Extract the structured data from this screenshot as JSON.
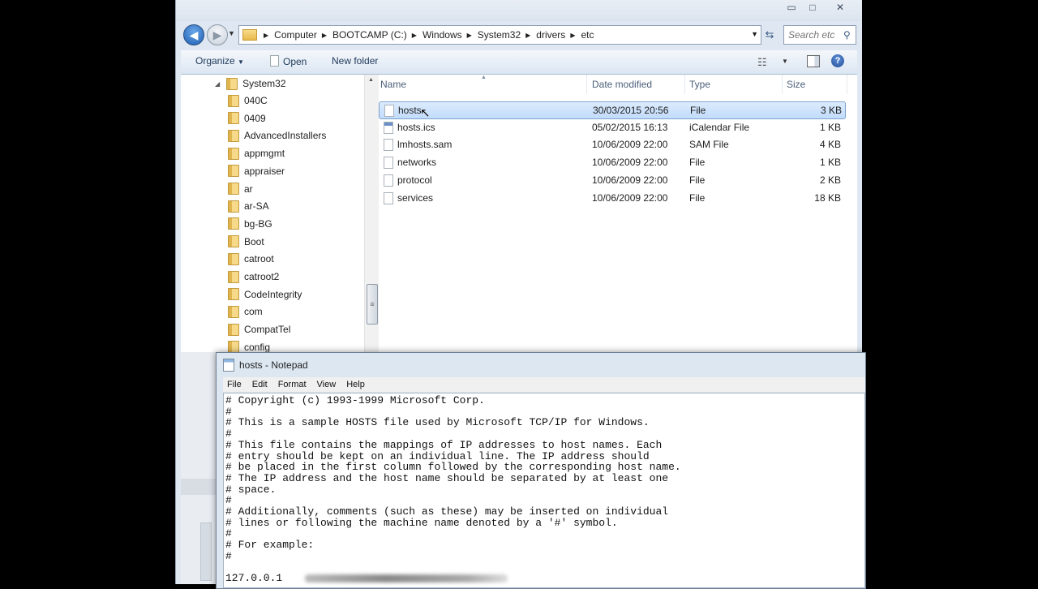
{
  "explorer": {
    "window_controls": {
      "minimize": "▭",
      "maximize": "□",
      "close": "✕"
    },
    "nav": {
      "back_glyph": "◀",
      "forward_glyph": "▶"
    },
    "breadcrumb": [
      {
        "label": "Computer"
      },
      {
        "label": "BOOTCAMP (C:)"
      },
      {
        "label": "Windows"
      },
      {
        "label": "System32"
      },
      {
        "label": "drivers"
      },
      {
        "label": "etc"
      }
    ],
    "search": {
      "placeholder": "Search etc"
    },
    "toolbar": {
      "organize_label": "Organize",
      "open_label": "Open",
      "new_folder_label": "New folder"
    },
    "tree": {
      "root": "System32",
      "items": [
        "040C",
        "0409",
        "AdvancedInstallers",
        "appmgmt",
        "appraiser",
        "ar",
        "ar-SA",
        "bg-BG",
        "Boot",
        "catroot",
        "catroot2",
        "CodeIntegrity",
        "com",
        "CompatTel",
        "config"
      ]
    },
    "columns": {
      "name": "Name",
      "date_modified": "Date modified",
      "type": "Type",
      "size": "Size"
    },
    "files": [
      {
        "name": "hosts",
        "date": "30/03/2015 20:56",
        "type": "File",
        "size": "3 KB",
        "selected": true,
        "icon": "file-icon"
      },
      {
        "name": "hosts.ics",
        "date": "05/02/2015 16:13",
        "type": "iCalendar File",
        "size": "1 KB",
        "selected": false,
        "icon": "calendar-file-icon"
      },
      {
        "name": "lmhosts.sam",
        "date": "10/06/2009 22:00",
        "type": "SAM File",
        "size": "4 KB",
        "selected": false,
        "icon": "file-icon"
      },
      {
        "name": "networks",
        "date": "10/06/2009 22:00",
        "type": "File",
        "size": "1 KB",
        "selected": false,
        "icon": "file-icon"
      },
      {
        "name": "protocol",
        "date": "10/06/2009 22:00",
        "type": "File",
        "size": "2 KB",
        "selected": false,
        "icon": "file-icon"
      },
      {
        "name": "services",
        "date": "10/06/2009 22:00",
        "type": "File",
        "size": "18 KB",
        "selected": false,
        "icon": "file-icon"
      }
    ]
  },
  "notepad": {
    "title": "hosts - Notepad",
    "menu": [
      "File",
      "Edit",
      "Format",
      "View",
      "Help"
    ],
    "lines": [
      "# Copyright (c) 1993-1999 Microsoft Corp.",
      "#",
      "# This is a sample HOSTS file used by Microsoft TCP/IP for Windows.",
      "#",
      "# This file contains the mappings of IP addresses to host names. Each",
      "# entry should be kept on an individual line. The IP address should",
      "# be placed in the first column followed by the corresponding host name.",
      "# The IP address and the host name should be separated by at least one",
      "# space.",
      "#",
      "# Additionally, comments (such as these) may be inserted on individual",
      "# lines or following the machine name denoted by a '#' symbol.",
      "#",
      "# For example:",
      "#",
      "",
      "127.0.0.1"
    ]
  },
  "colors": {
    "selection_bg": "#c1dcfc",
    "selection_border": "#7da2ce",
    "chrome": "#dfe8f2",
    "header_text": "#4c607a"
  }
}
